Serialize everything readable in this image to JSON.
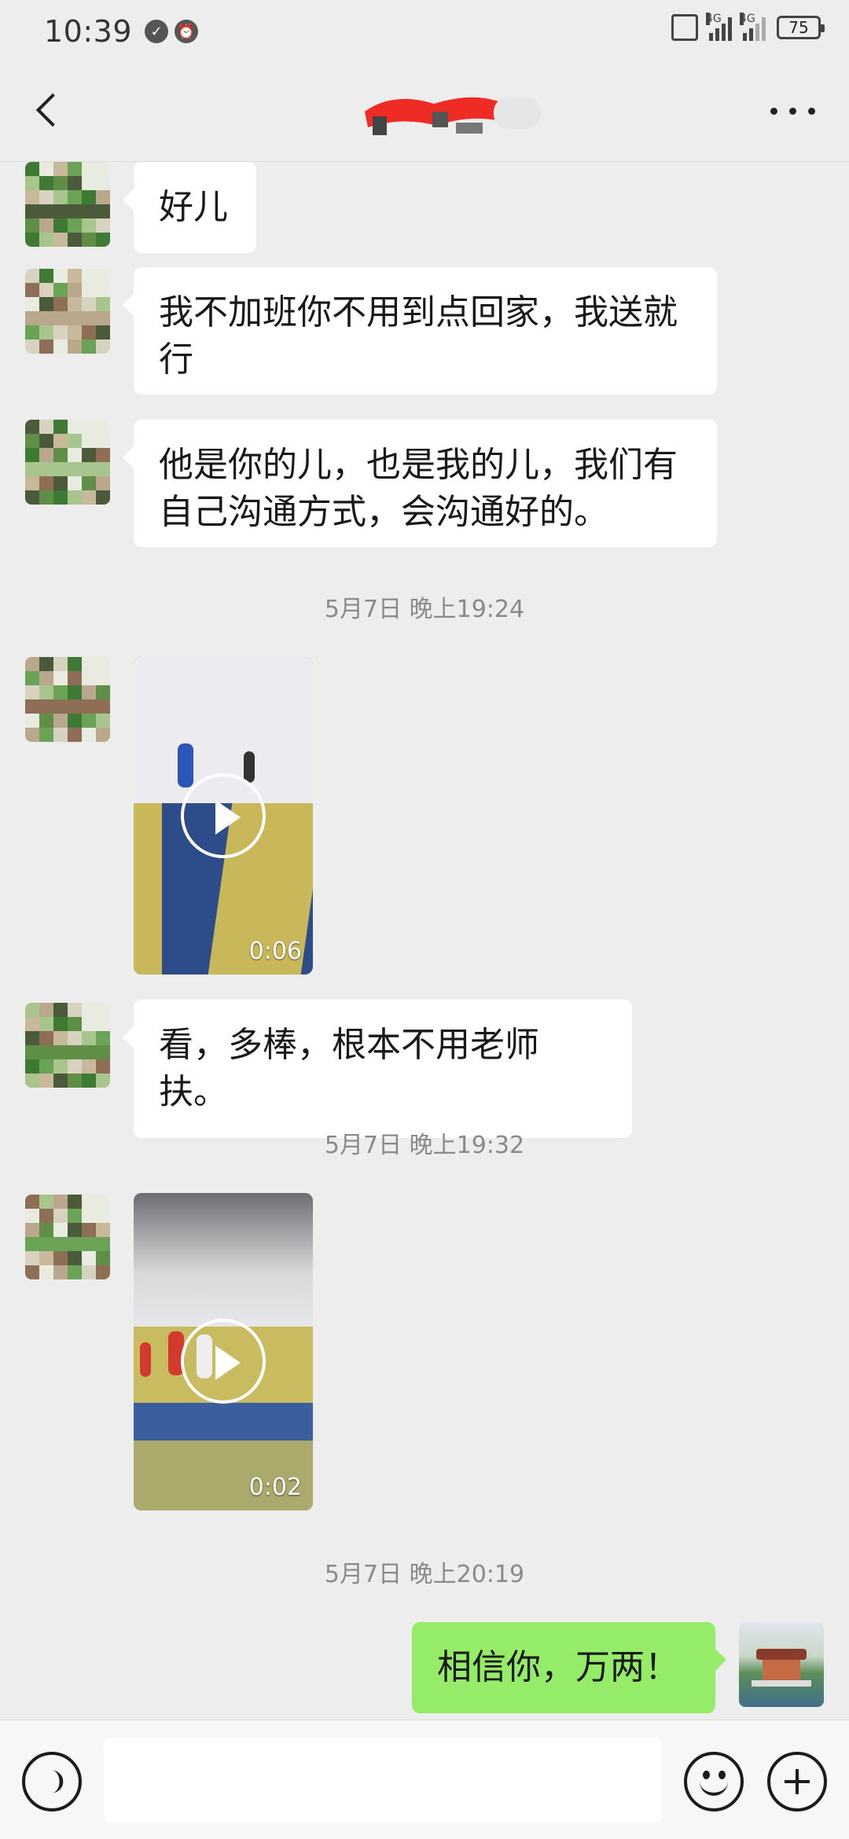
{
  "status_bar": {
    "time": "10:39",
    "network_left": "4G",
    "network_right": "4G",
    "battery": "75"
  },
  "header": {
    "title": ""
  },
  "messages": [
    {
      "text": "好儿",
      "side": "left"
    },
    {
      "text": "我不加班你不用到点回家，我送就行",
      "side": "left"
    },
    {
      "text": "他是你的儿，也是我的儿，我们有自己沟通方式，会沟通好的。",
      "side": "left"
    },
    {
      "timestamp": "5月7日 晚上19:24"
    },
    {
      "video_duration": "0:06",
      "side": "left"
    },
    {
      "text": "看，多棒，根本不用老师扶。",
      "side": "left"
    },
    {
      "timestamp": "5月7日 晚上19:32"
    },
    {
      "video_duration": "0:02",
      "side": "left"
    },
    {
      "timestamp": "5月7日 晚上20:19"
    },
    {
      "text": "相信你，万两！",
      "side": "right"
    }
  ],
  "input_bar": {
    "placeholder": "",
    "icons": [
      "voice-icon",
      "emoji-icon",
      "plus-icon"
    ]
  },
  "colors": {
    "background": "#ededed",
    "incoming_bubble": "#ffffff",
    "outgoing_bubble": "#95ec69",
    "timestamp_text": "#8a8a8a"
  }
}
